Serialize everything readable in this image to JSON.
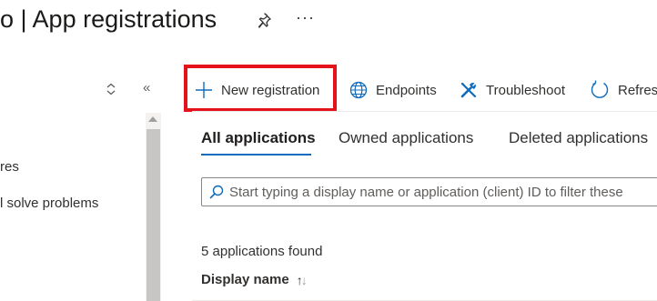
{
  "header": {
    "title": "o | App registrations",
    "pin_icon": "pin-icon",
    "more_label": "···"
  },
  "left_nav": {
    "updown_icon": "chevron-updown-icon",
    "collapse_label": "«",
    "items": [
      {
        "label": "res"
      },
      {
        "label": "l solve problems"
      }
    ]
  },
  "command_bar": {
    "new_registration": "New registration",
    "endpoints": "Endpoints",
    "troubleshoot": "Troubleshoot",
    "refresh": "Refres",
    "highlight_color": "#e3121b",
    "icon_color": "#0f6cbd"
  },
  "tabs": [
    {
      "label": "All applications",
      "active": true
    },
    {
      "label": "Owned applications",
      "active": false
    },
    {
      "label": "Deleted applications",
      "active": false
    }
  ],
  "search": {
    "placeholder": "Start typing a display name or application (client) ID to filter these",
    "value": ""
  },
  "results": {
    "count_text": "5 applications found",
    "column_header": "Display name",
    "sort_icon": "sort-ascending-icon"
  }
}
